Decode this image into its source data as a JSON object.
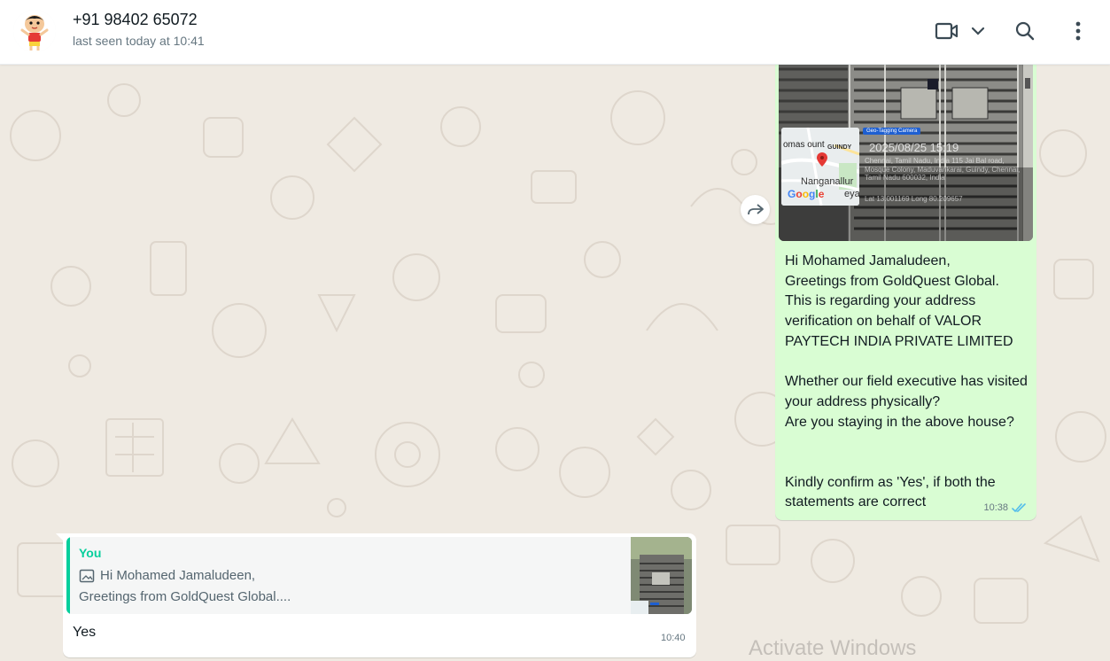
{
  "header": {
    "contact_name": "+91 98402 65072",
    "contact_status": "last seen today at 10:41",
    "icons": [
      "avatar-cartoon",
      "video-call-icon",
      "chevron-down-icon",
      "search-icon",
      "more-vertical-icon"
    ]
  },
  "outgoing_message": {
    "image": {
      "geo_tag_label": "Geo-Tagging Camera",
      "date_time": "2025/08/25 15:19",
      "address": "Chennai, Tamil Nadu, India 115 Jai Bal road, Mosque Colony, Maduvankarai, Guindy, Chennai, Tamil Nadu 600032, India",
      "lat_lng": "Lat 13.001169 Long 80.209657",
      "map_labels": [
        "omas ount",
        "GUINDY",
        "Nanganallur",
        "Google",
        "eyar Ter"
      ]
    },
    "text": "Hi Mohamed Jamaludeen,\nGreetings from GoldQuest Global.\nThis is regarding your address verification on behalf of VALOR PAYTECH INDIA PRIVATE LIMITED\n\nWhether our field executive has visited your address physically?\nAre you staying in the above house?\n\n\nKindly confirm as 'Yes', if both the statements are correct",
    "time": "10:38",
    "status_icon": "double-check-read-icon"
  },
  "incoming_message": {
    "quote_author": "You",
    "quote_line1": "Hi Mohamed Jamaludeen,",
    "quote_line2": "Greetings from GoldQuest Global....",
    "text": "Yes",
    "time": "10:40"
  },
  "colors": {
    "outgoing_bubble": "#d9fdd3",
    "incoming_bubble": "#ffffff",
    "chat_background": "#efeae2",
    "quote_accent": "#06cf9c",
    "read_ticks": "#53bdeb"
  },
  "watermark": "Activate Windows"
}
